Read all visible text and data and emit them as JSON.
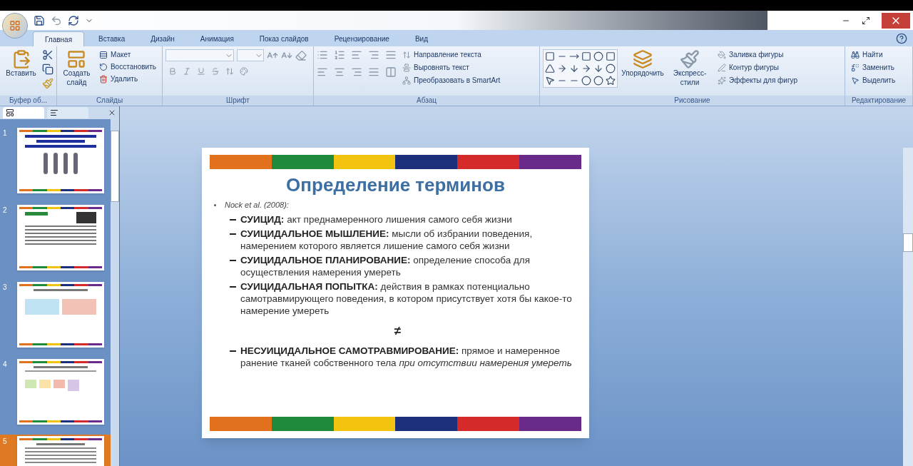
{
  "tabs": [
    {
      "label": "Главная",
      "selected": true
    },
    {
      "label": "Вставка",
      "selected": false
    },
    {
      "label": "Дизайн",
      "selected": false
    },
    {
      "label": "Анимация",
      "selected": false
    },
    {
      "label": "Показ слайдов",
      "selected": false
    },
    {
      "label": "Рецензирование",
      "selected": false
    },
    {
      "label": "Вид",
      "selected": false
    }
  ],
  "ribbon": [
    {
      "label": "Буфер об...",
      "buttons": [
        "Вставить"
      ]
    },
    {
      "label": "Слайды",
      "buttons": [
        "Создать слайд",
        "Макет",
        "Восстановить",
        "Удалить"
      ]
    },
    {
      "label": "Шрифт"
    },
    {
      "label": "Абзац",
      "buttons": [
        "Направление текста",
        "Выровнять текст",
        "Преобразовать в SmartArt"
      ]
    },
    {
      "label": "Рисование",
      "buttons": [
        "Упорядочить",
        "Экспресс-стили",
        "Заливка фигуры",
        "Контур фигуры",
        "Эффекты для фигур"
      ]
    },
    {
      "label": "Редактирование",
      "buttons": [
        "Найти",
        "Заменить",
        "Выделить"
      ]
    }
  ],
  "slides": [
    {
      "number": "1",
      "selected": false
    },
    {
      "number": "2",
      "selected": false
    },
    {
      "number": "3",
      "selected": false
    },
    {
      "number": "4",
      "selected": false
    },
    {
      "number": "5",
      "selected": true
    }
  ],
  "slide": {
    "title": "Определение терминов",
    "source": "Nock et al. (2008):",
    "items": [
      {
        "kind": "definition",
        "term": "СУИЦИД:",
        "text": "акт преднамеренного лишения самого себя жизни"
      },
      {
        "kind": "definition",
        "term": "СУИЦИДАЛЬНОЕ МЫШЛЕНИЕ:",
        "text": "мысли об избрании поведения, намерением которого является лишение самого себя жизни"
      },
      {
        "kind": "definition",
        "term": "СУИЦИДАЛЬНОЕ ПЛАНИРОВАНИЕ:",
        "text": "определение способа для осуществления намерения умереть"
      },
      {
        "kind": "definition",
        "term": "СУИЦИДАЛЬНАЯ ПОПЫТКА:",
        "text": "действия в рамках потенциально самотравмирующего поведения, в котором присутствует хотя бы какое-то намерение умереть"
      },
      {
        "kind": "symbol",
        "text": "≠"
      },
      {
        "kind": "definition",
        "term": "НЕСУИЦИДАЛЬНОЕ САМОТРАВМИРОВАНИЕ:",
        "text": "прямое и намеренное ранение тканей собственного тела *при отсутствии намерения умереть*"
      }
    ]
  }
}
